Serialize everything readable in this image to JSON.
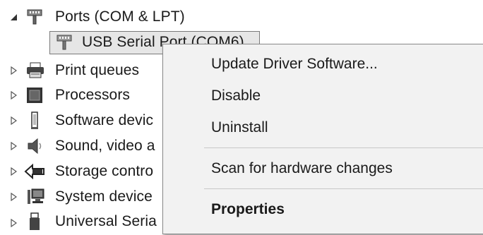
{
  "tree": {
    "category": {
      "label": "Ports (COM & LPT)",
      "expanded": true,
      "icon": "port-icon"
    },
    "child": {
      "label": "USB Serial Port (COM6)",
      "icon": "port-icon"
    },
    "items": [
      {
        "label": "Print queues",
        "icon": "printer-icon"
      },
      {
        "label": "Processors",
        "icon": "processor-icon"
      },
      {
        "label": "Software devic",
        "icon": "software-device-icon"
      },
      {
        "label": "Sound, video a",
        "icon": "speaker-icon"
      },
      {
        "label": "Storage contro",
        "icon": "storage-icon"
      },
      {
        "label": "System device",
        "icon": "system-device-icon"
      },
      {
        "label": "Universal Seria",
        "icon": "usb-icon"
      }
    ]
  },
  "context_menu": {
    "items": [
      {
        "label": "Update Driver Software...",
        "bold": false
      },
      {
        "label": "Disable",
        "bold": false
      },
      {
        "label": "Uninstall",
        "bold": false
      },
      {
        "label": "Scan for hardware changes",
        "bold": false
      },
      {
        "label": "Properties",
        "bold": true
      }
    ]
  }
}
